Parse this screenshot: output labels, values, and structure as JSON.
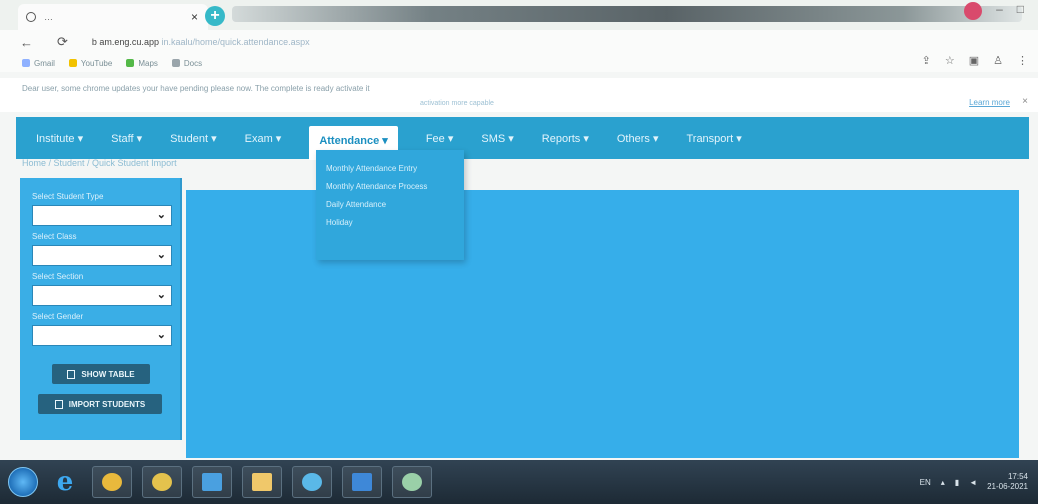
{
  "browser": {
    "tab_title": "…",
    "tab_close": "×",
    "new_tab": "+",
    "url_main": "b  am.eng.cu.app",
    "url_dim": "in.kaalu/home/quick.attendance.aspx",
    "bookmarks": [
      "Gmail",
      "YouTube",
      "Maps",
      "Docs"
    ]
  },
  "notice": {
    "text": "Dear user, some chrome updates your have pending please now. The complete is ready activate it",
    "subtext": "activation more capable",
    "learn_more": "Learn more",
    "close": "×"
  },
  "nav": {
    "items": [
      {
        "label": "Institute ▾",
        "active": false
      },
      {
        "label": "Staff ▾",
        "active": false
      },
      {
        "label": "Student ▾",
        "active": false
      },
      {
        "label": "Exam ▾",
        "active": false
      },
      {
        "label": "Attendance ▾",
        "active": true
      },
      {
        "label": "Fee ▾",
        "active": false
      },
      {
        "label": "SMS ▾",
        "active": false
      },
      {
        "label": "Reports ▾",
        "active": false
      },
      {
        "label": "Others ▾",
        "active": false
      },
      {
        "label": "Transport ▾",
        "active": false
      }
    ]
  },
  "breadcrumb": "Home  /  Student  /  Quick Student Import",
  "dropdown": {
    "items": [
      "Monthly Attendance Entry",
      "Monthly Attendance Process",
      "Daily Attendance",
      "Holiday"
    ]
  },
  "sidebar": {
    "student_type_label": "Select Student Type",
    "class_label": "Select Class",
    "section_label": "Select Section",
    "gender_label": "Select Gender",
    "show_table_label": "SHOW TABLE",
    "import_label": "IMPORT STUDENTS"
  },
  "taskbar": {
    "tray_lang": "EN",
    "time": "17:54",
    "date": "21-06-2021"
  },
  "colors": {
    "nav": "#2aa1cf",
    "panel": "#36aeea",
    "button": "#26627f"
  }
}
